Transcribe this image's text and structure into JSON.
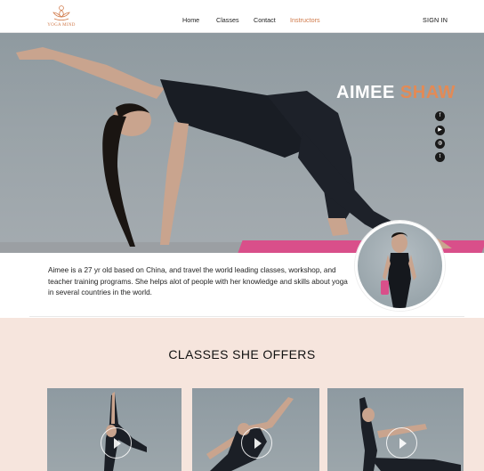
{
  "brand": {
    "logo_text": "YOGA MIND",
    "accent": "#d07a4a"
  },
  "nav": {
    "items": [
      {
        "label": "Home",
        "active": false
      },
      {
        "label": "Classes",
        "active": false
      },
      {
        "label": "Contact",
        "active": false
      },
      {
        "label": "Instructors",
        "active": true
      }
    ],
    "signin_label": "SIGN IN"
  },
  "hero": {
    "first_name": "AIMEE",
    "last_name": "SHAW",
    "social_icons": [
      "facebook-icon",
      "youtube-icon",
      "globe-icon",
      "twitter-icon"
    ]
  },
  "bio": {
    "text": "Aimee is a 27 yr old based on China, and travel the world leading classes, workshop, and teacher training programs. She helps alot of people with her knowledge and skills about yoga in several countries in the world."
  },
  "classes": {
    "title": "CLASSES SHE OFFERS",
    "cards": [
      {
        "icon": "play-icon"
      },
      {
        "icon": "play-icon"
      },
      {
        "icon": "play-icon"
      }
    ]
  },
  "colors": {
    "accent": "#e38a55",
    "section_bg": "#f6e5dd",
    "mat": "#d94f8a"
  }
}
